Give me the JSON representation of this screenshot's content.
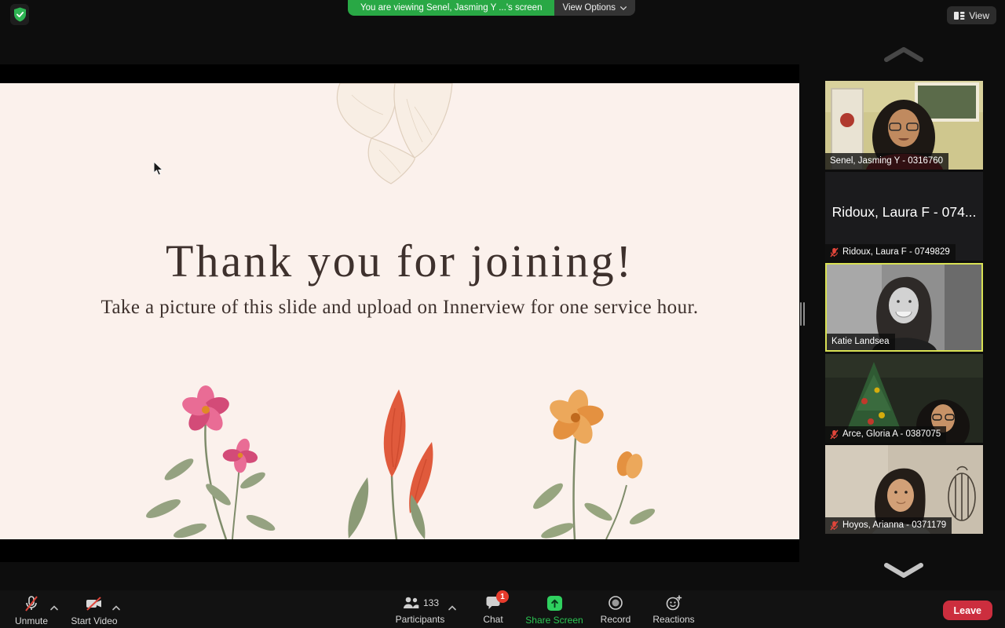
{
  "window": {
    "type": "zoom-meeting"
  },
  "top_bar": {
    "banner_text": "You are viewing Senel, Jasming Y ...'s screen",
    "view_options_label": "View Options",
    "view_button_label": "View"
  },
  "shared_slide": {
    "title": "Thank you for joining!",
    "subtitle": "Take a picture of this slide and upload on Innerview for one service hour."
  },
  "sidebar": {
    "participants": [
      {
        "label": "Senel, Jasming Y - 0316760",
        "muted": false,
        "camera_on": true,
        "active_speaker": false
      },
      {
        "display_name": "Ridoux, Laura F - 074...",
        "label": "Ridoux, Laura F - 0749829",
        "muted": true,
        "camera_on": false,
        "active_speaker": false
      },
      {
        "label": "Katie Landsea",
        "muted": false,
        "camera_on": true,
        "active_speaker": true
      },
      {
        "label": "Arce, Gloria A - 0387075",
        "muted": true,
        "camera_on": true,
        "active_speaker": false
      },
      {
        "label": "Hoyos, Arianna - 0371179",
        "muted": true,
        "camera_on": true,
        "active_speaker": false
      }
    ]
  },
  "toolbar": {
    "unmute_label": "Unmute",
    "start_video_label": "Start Video",
    "participants_label": "Participants",
    "participants_count": "133",
    "chat_label": "Chat",
    "chat_badge_count": "1",
    "share_screen_label": "Share Screen",
    "record_label": "Record",
    "reactions_label": "Reactions",
    "leave_label": "Leave"
  },
  "icons": {
    "security": "shield-check-icon",
    "view": "layout-view-icon",
    "view_options_chevron": "chevron-down-icon",
    "unmute": "microphone-slash-icon",
    "start_video": "video-camera-slash-icon",
    "participants": "people-icon",
    "chat": "chat-bubble-icon",
    "share_screen": "share-screen-arrow-icon",
    "record": "record-circle-icon",
    "reactions": "smiley-plus-icon",
    "muted_participant": "muted-mic-icon",
    "scroll_up": "chevron-up-icon",
    "scroll_down": "chevron-down-icon"
  },
  "colors": {
    "banner_green": "#29A845",
    "share_green": "#2BC652",
    "leave_red": "#CC2E3E",
    "chat_badge_red": "#E73B2C",
    "muted_red": "#E0453A",
    "active_speaker_border": "#D9E154",
    "slide_background": "#FBF1EC",
    "slide_text": "#3E312D"
  }
}
